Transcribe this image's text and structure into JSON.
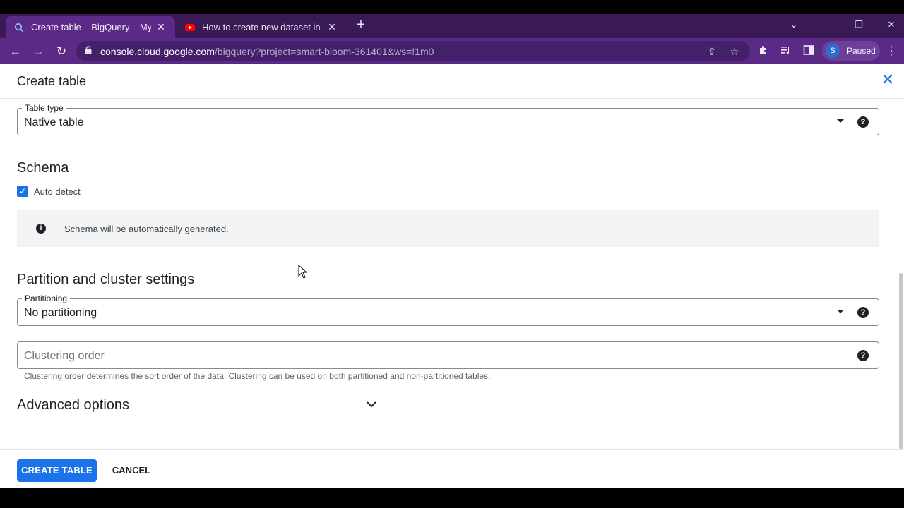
{
  "browser": {
    "tabs": [
      {
        "title": "Create table – BigQuery – My First",
        "favicon": "bigquery-icon",
        "active": true
      },
      {
        "title": "How to create new dataset in Go",
        "favicon": "youtube-icon",
        "active": false
      }
    ],
    "url_host": "console.cloud.google.com",
    "url_path": "/bigquery?project=smart-bloom-361401&ws=!1m0",
    "profile_initial": "S",
    "profile_status": "Paused",
    "colors": {
      "frame": "#3a1a55",
      "toolbar": "#5b2a86"
    }
  },
  "panel": {
    "title": "Create table",
    "table_type": {
      "label": "Table type",
      "value": "Native table"
    },
    "schema": {
      "heading": "Schema",
      "auto_detect_label": "Auto detect",
      "auto_detect_checked": true,
      "info": "Schema will be automatically generated."
    },
    "partition": {
      "heading": "Partition and cluster settings",
      "partitioning_label": "Partitioning",
      "partitioning_value": "No partitioning",
      "clustering_placeholder": "Clustering order",
      "clustering_hint": "Clustering order determines the sort order of the data. Clustering can be used on both partitioned and non-partitioned tables."
    },
    "advanced": {
      "heading": "Advanced options"
    },
    "footer": {
      "create_label": "CREATE TABLE",
      "cancel_label": "CANCEL"
    },
    "colors": {
      "primary": "#1a73e8"
    }
  }
}
